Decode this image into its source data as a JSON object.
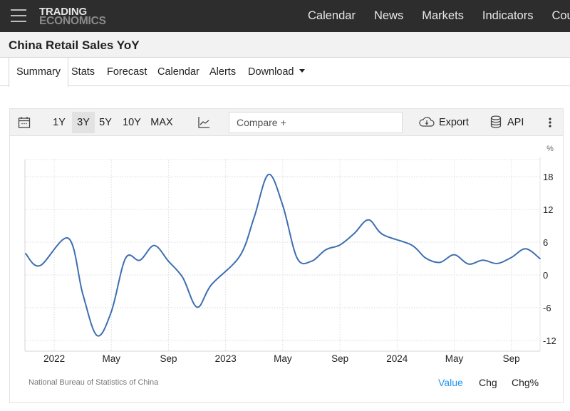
{
  "header": {
    "logo_line1": "TRADING",
    "logo_line2": "ECONOMICS",
    "nav": [
      "Calendar",
      "News",
      "Markets",
      "Indicators",
      "Countries"
    ]
  },
  "page_title": "China Retail Sales YoY",
  "tabs": [
    {
      "label": "Summary",
      "active": true
    },
    {
      "label": "Stats"
    },
    {
      "label": "Forecast"
    },
    {
      "label": "Calendar"
    },
    {
      "label": "Alerts"
    },
    {
      "label": "Download"
    }
  ],
  "toolbar": {
    "ranges": [
      "1Y",
      "3Y",
      "5Y",
      "10Y",
      "MAX"
    ],
    "selected_range": "3Y",
    "compare_placeholder": "Compare +",
    "export_label": "Export",
    "api_label": "API"
  },
  "footer": {
    "source": "National Bureau of Statistics of China",
    "modes": [
      "Value",
      "Chg",
      "Chg%"
    ],
    "active_mode": "Value"
  },
  "colors": {
    "line": "#3e6fb0",
    "active_mode": "#2196f3",
    "topbar": "#2d2d2d"
  },
  "chart_data": {
    "type": "line",
    "title": "China Retail Sales YoY",
    "unit_label": "%",
    "xlabel": "",
    "ylabel": "%",
    "ylim": [
      -14,
      22
    ],
    "yticks": [
      18,
      12,
      6,
      0,
      -6,
      -12
    ],
    "y_axis_position": "right",
    "grid": true,
    "xticks": [
      {
        "label": "2022",
        "date": "2022-01"
      },
      {
        "label": "May",
        "date": "2022-05"
      },
      {
        "label": "Sep",
        "date": "2022-09"
      },
      {
        "label": "2023",
        "date": "2023-01"
      },
      {
        "label": "May",
        "date": "2023-05"
      },
      {
        "label": "Sep",
        "date": "2023-09"
      },
      {
        "label": "2024",
        "date": "2024-01"
      },
      {
        "label": "May",
        "date": "2024-05"
      },
      {
        "label": "Sep",
        "date": "2024-09"
      }
    ],
    "xlim": [
      "2021-11",
      "2024-11"
    ],
    "series": [
      {
        "name": "China Retail Sales YoY",
        "points": [
          {
            "date": "2021-11",
            "value": 3.9
          },
          {
            "date": "2021-12",
            "value": 1.7
          },
          {
            "date": "2022-02",
            "value": 6.7
          },
          {
            "date": "2022-03",
            "value": -3.5
          },
          {
            "date": "2022-04",
            "value": -11.1
          },
          {
            "date": "2022-05",
            "value": -6.7
          },
          {
            "date": "2022-06",
            "value": 3.1
          },
          {
            "date": "2022-07",
            "value": 2.7
          },
          {
            "date": "2022-08",
            "value": 5.4
          },
          {
            "date": "2022-09",
            "value": 2.5
          },
          {
            "date": "2022-10",
            "value": -0.5
          },
          {
            "date": "2022-11",
            "value": -5.9
          },
          {
            "date": "2022-12",
            "value": -1.8
          },
          {
            "date": "2023-02",
            "value": 3.5
          },
          {
            "date": "2023-03",
            "value": 10.6
          },
          {
            "date": "2023-04",
            "value": 18.4
          },
          {
            "date": "2023-05",
            "value": 12.7
          },
          {
            "date": "2023-06",
            "value": 3.1
          },
          {
            "date": "2023-07",
            "value": 2.5
          },
          {
            "date": "2023-08",
            "value": 4.6
          },
          {
            "date": "2023-09",
            "value": 5.5
          },
          {
            "date": "2023-10",
            "value": 7.6
          },
          {
            "date": "2023-11",
            "value": 10.1
          },
          {
            "date": "2023-12",
            "value": 7.4
          },
          {
            "date": "2024-02",
            "value": 5.5
          },
          {
            "date": "2024-03",
            "value": 3.1
          },
          {
            "date": "2024-04",
            "value": 2.3
          },
          {
            "date": "2024-05",
            "value": 3.7
          },
          {
            "date": "2024-06",
            "value": 2.0
          },
          {
            "date": "2024-07",
            "value": 2.7
          },
          {
            "date": "2024-08",
            "value": 2.1
          },
          {
            "date": "2024-09",
            "value": 3.2
          },
          {
            "date": "2024-10",
            "value": 4.8
          },
          {
            "date": "2024-11",
            "value": 3.0
          }
        ]
      }
    ]
  }
}
